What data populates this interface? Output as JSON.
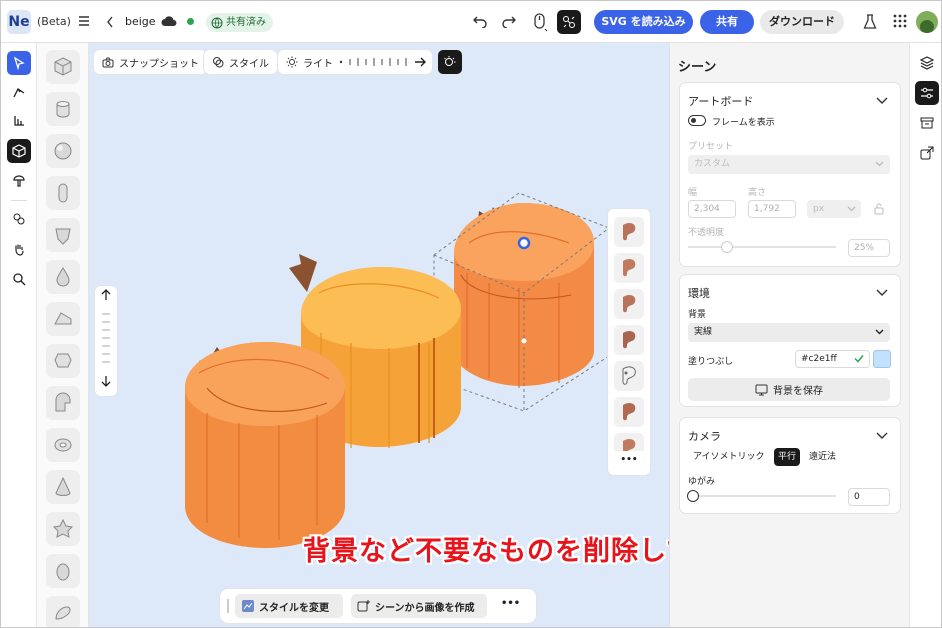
{
  "header": {
    "logo": "Ne",
    "beta": "(Beta)",
    "doc_name": "beige",
    "share_status": "共有済み",
    "svg_button": "SVG を読み込み",
    "share_button": "共有",
    "download_button": "ダウンロード"
  },
  "canvas_toolbar": {
    "snapshot": "スナップショット",
    "style": "スタイル",
    "light": "ライト"
  },
  "bottom_bar": {
    "change_style": "スタイルを変更",
    "create_image": "シーンから画像を作成",
    "more": "•••"
  },
  "annotation": "背景など不要なものを削除して完成",
  "panel": {
    "title": "シーン",
    "artboard": {
      "title": "アートボード",
      "show_frame": "フレームを表示",
      "preset_label": "プリセット",
      "preset_value": "カスタム",
      "width_label": "幅",
      "width_value": "2,304",
      "height_label": "高さ",
      "height_value": "1,792",
      "unit": "px",
      "opacity_label": "不透明度",
      "opacity_value": "25%"
    },
    "environment": {
      "title": "環境",
      "background_label": "背景",
      "background_value": "実線",
      "fill_label": "塗りつぶし",
      "fill_value": "#c2e1ff",
      "save_background": "背景を保存"
    },
    "camera": {
      "title": "カメラ",
      "modes": [
        "アイソメトリック",
        "平行",
        "遠近法"
      ],
      "active_mode": "平行",
      "distortion_label": "ゆがみ",
      "distortion_value": "0"
    }
  },
  "colors": {
    "accent": "#3b63e8",
    "canvas_bg": "#dde9f8",
    "fill_swatch": "#c2e1ff",
    "annotation": "#e8141c"
  }
}
